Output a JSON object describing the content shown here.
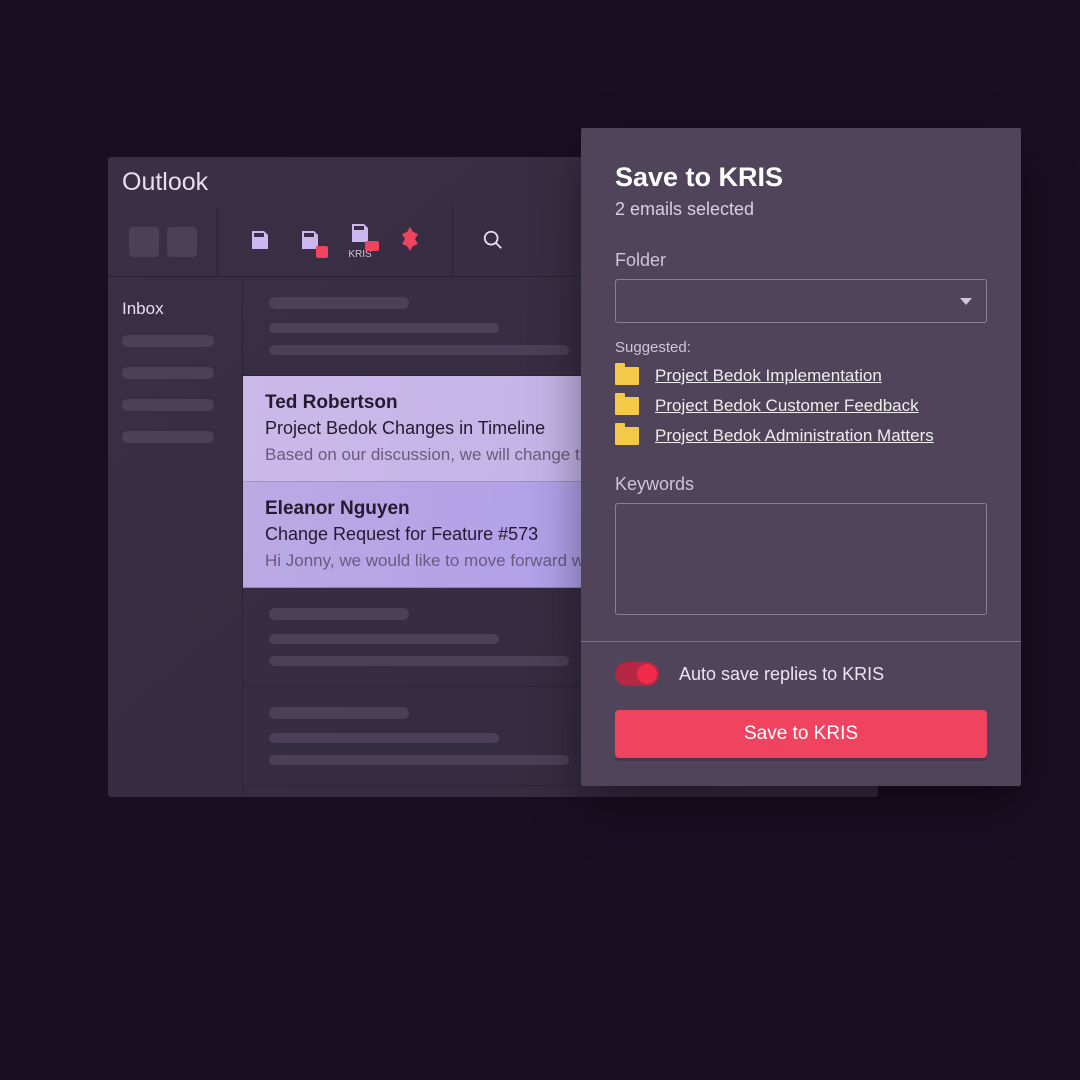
{
  "outlook": {
    "title": "Outlook",
    "kris_tab_label": "KRIS",
    "inbox_label": "Inbox"
  },
  "emails": [
    {
      "from": "Ted Robertson",
      "subject": "Project Bedok Changes in Timeline",
      "preview": "Based on our discussion, we will change the"
    },
    {
      "from": "Eleanor Nguyen",
      "subject": "Change Request for Feature #573",
      "preview": "Hi Jonny, we would like to move forward with"
    }
  ],
  "dialog": {
    "title": "Save to KRIS",
    "subtitle": "2 emails selected",
    "folder_label": "Folder",
    "suggested_label": "Suggested:",
    "suggestions": [
      "Project Bedok Implementation",
      "Project Bedok Customer Feedback",
      "Project Bedok Administration Matters"
    ],
    "keywords_label": "Keywords",
    "toggle_label": "Auto save replies to KRIS",
    "toggle_on": true,
    "button_label": "Save to KRIS"
  },
  "colors": {
    "accent": "#ef435f",
    "folder": "#f5c948"
  }
}
